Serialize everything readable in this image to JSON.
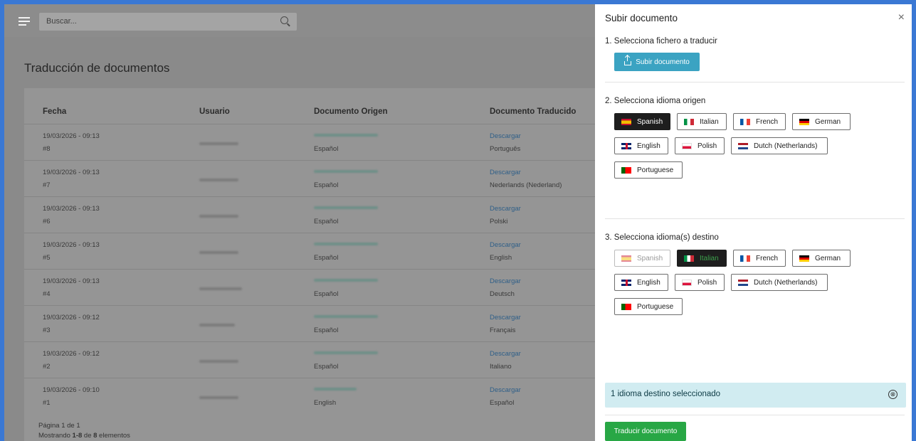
{
  "topbar": {
    "search_placeholder": "Buscar..."
  },
  "page": {
    "title": "Traducción de documentos"
  },
  "table": {
    "headers": [
      "Fecha",
      "Usuario",
      "Documento Origen",
      "Documento Traducido"
    ],
    "rows": [
      {
        "date": "19/03/2026 - 09:13",
        "id": "#8",
        "origin_lang": "Español",
        "link": "Descargar",
        "target_lang": "Português"
      },
      {
        "date": "19/03/2026 - 09:13",
        "id": "#7",
        "origin_lang": "Español",
        "link": "Descargar",
        "target_lang": "Nederlands (Nederland)"
      },
      {
        "date": "19/03/2026 - 09:13",
        "id": "#6",
        "origin_lang": "Español",
        "link": "Descargar",
        "target_lang": "Polski"
      },
      {
        "date": "19/03/2026 - 09:13",
        "id": "#5",
        "origin_lang": "Español",
        "link": "Descargar",
        "target_lang": "English"
      },
      {
        "date": "19/03/2026 - 09:13",
        "id": "#4",
        "origin_lang": "Español",
        "link": "Descargar",
        "target_lang": "Deutsch"
      },
      {
        "date": "19/03/2026 - 09:12",
        "id": "#3",
        "origin_lang": "Español",
        "link": "Descargar",
        "target_lang": "Français"
      },
      {
        "date": "19/03/2026 - 09:12",
        "id": "#2",
        "origin_lang": "Español",
        "link": "Descargar",
        "target_lang": "Italiano"
      },
      {
        "date": "19/03/2026 - 09:10",
        "id": "#1",
        "origin_lang": "English",
        "link": "Descargar",
        "target_lang": "Español"
      }
    ],
    "footer_page": "Página 1 de 1",
    "footer_count_prefix": "Mostrando ",
    "footer_count_range": "1-8",
    "footer_count_mid": " de ",
    "footer_count_total": "8",
    "footer_count_suffix": " elementos"
  },
  "panel": {
    "title": "Subir documento",
    "close": "×",
    "step1": "1. Selecciona fichero a traducir",
    "upload_label": "Subir documento",
    "step2": "2. Selecciona idioma origen",
    "step3": "3. Selecciona idioma(s) destino",
    "languages": [
      "Spanish",
      "Italian",
      "French",
      "German",
      "English",
      "Polish",
      "Dutch (Netherlands)",
      "Portuguese"
    ],
    "source_selected": "Spanish",
    "target_selected": [
      "Italian"
    ],
    "target_disabled": [
      "Spanish"
    ],
    "info_text": "1 idioma destino seleccionado",
    "info_close": "⊗",
    "submit_label": "Traducir documento"
  },
  "colors": {
    "upload": "#3ba3c2",
    "submit": "#28a745",
    "info_bg": "#d1ecf1",
    "selected": "#1e1e1e",
    "frame": "#3a78d4"
  }
}
